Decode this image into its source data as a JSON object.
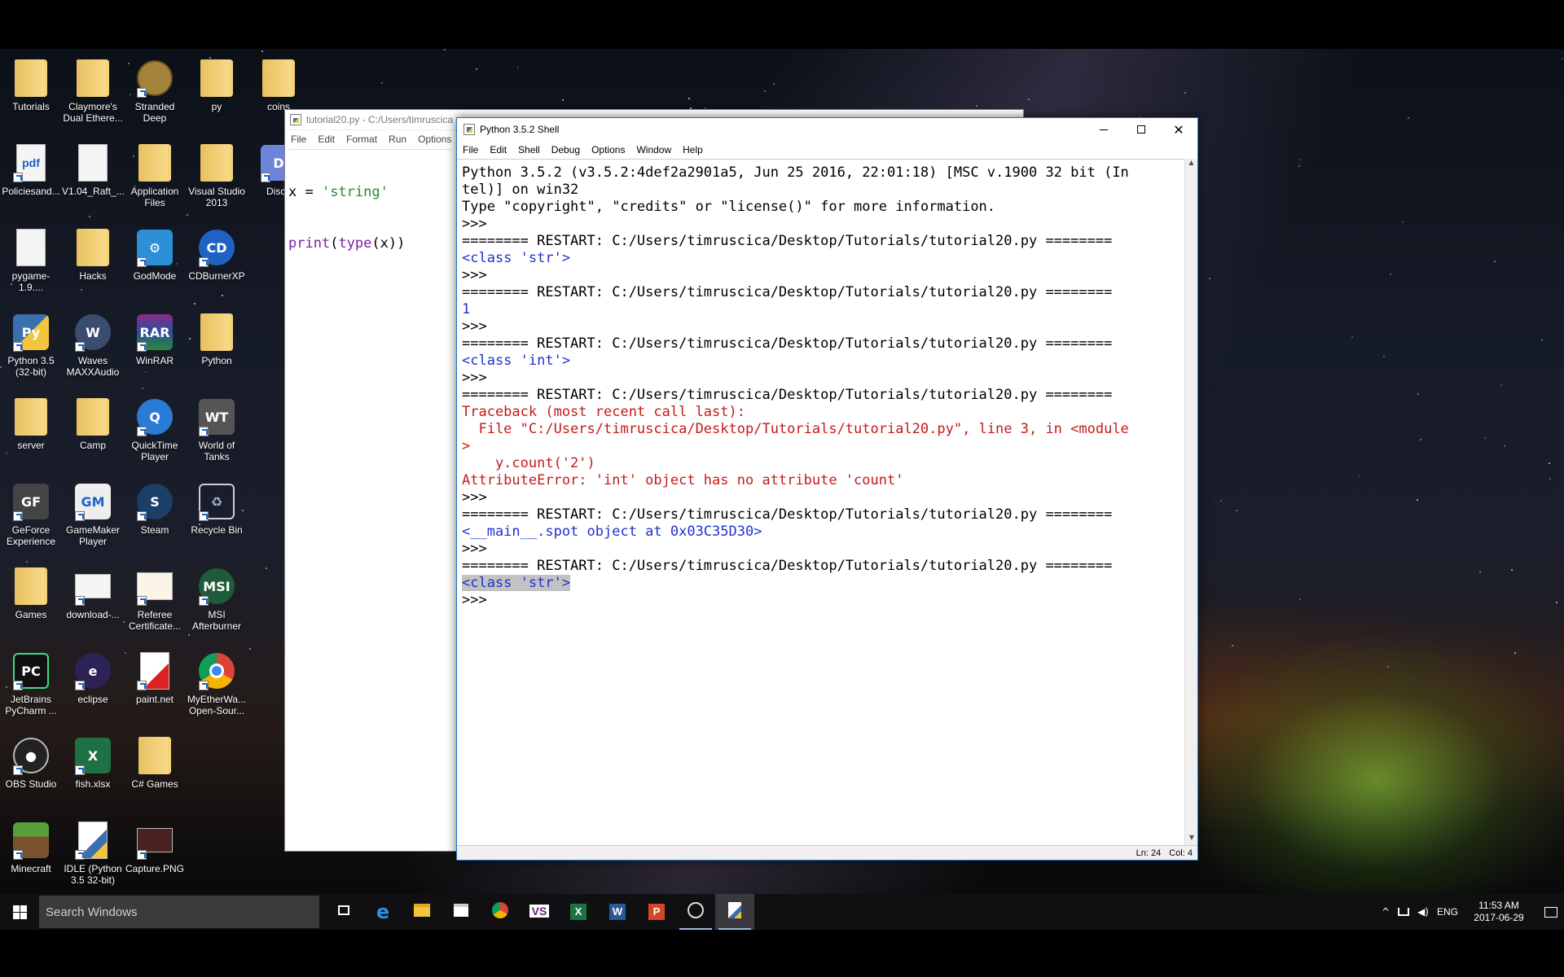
{
  "desktop_icons": [
    {
      "label": "Tutorials",
      "kind": "folder"
    },
    {
      "label": "Claymore's Dual Ethere...",
      "kind": "folder"
    },
    {
      "label": "Stranded Deep",
      "kind": "app-stranded"
    },
    {
      "label": "py",
      "kind": "folder"
    },
    {
      "label": "coins",
      "kind": "folder"
    },
    {
      "label": "Policiesand...",
      "kind": "pdf"
    },
    {
      "label": "V1.04_Raft_...",
      "kind": "doc"
    },
    {
      "label": "Application Files",
      "kind": "folder"
    },
    {
      "label": "Visual Studio 2013",
      "kind": "folder"
    },
    {
      "label": "Disco",
      "kind": "discord"
    },
    {
      "label": "pygame-1.9....",
      "kind": "doc"
    },
    {
      "label": "Hacks",
      "kind": "folder"
    },
    {
      "label": "GodMode",
      "kind": "godmode"
    },
    {
      "label": "CDBurnerXP",
      "kind": "cdburner"
    },
    {
      "label": "Python 3.5 (32-bit)",
      "kind": "python"
    },
    {
      "label": "Waves MAXXAudio",
      "kind": "waves"
    },
    {
      "label": "WinRAR",
      "kind": "winrar"
    },
    {
      "label": "Python",
      "kind": "folder"
    },
    {
      "label": "server",
      "kind": "folder"
    },
    {
      "label": "Camp",
      "kind": "folder"
    },
    {
      "label": "QuickTime Player",
      "kind": "quicktime"
    },
    {
      "label": "World of Tanks",
      "kind": "wot"
    },
    {
      "label": "GeForce Experience",
      "kind": "geforce"
    },
    {
      "label": "GameMaker Player",
      "kind": "gamemaker"
    },
    {
      "label": "Steam",
      "kind": "steam"
    },
    {
      "label": "Recycle Bin",
      "kind": "recycle"
    },
    {
      "label": "Games",
      "kind": "folder"
    },
    {
      "label": "download-...",
      "kind": "image"
    },
    {
      "label": "Referee Certificate...",
      "kind": "certificate"
    },
    {
      "label": "MSI Afterburner",
      "kind": "msi"
    },
    {
      "label": "JetBrains PyCharm ...",
      "kind": "pycharm"
    },
    {
      "label": "eclipse",
      "kind": "eclipse"
    },
    {
      "label": "paint.net",
      "kind": "paintnet"
    },
    {
      "label": "MyEtherWa... Open-Sour...",
      "kind": "chrome"
    },
    {
      "label": "OBS Studio",
      "kind": "obs"
    },
    {
      "label": "fish.xlsx",
      "kind": "excel"
    },
    {
      "label": "C# Games",
      "kind": "folder"
    },
    {
      "label": "Minecraft",
      "kind": "minecraft"
    },
    {
      "label": "IDLE (Python 3.5 32-bit)",
      "kind": "idle"
    },
    {
      "label": "Capture.PNG",
      "kind": "capture"
    }
  ],
  "editor": {
    "title": "tutorial20.py - C:/Users/timruscica",
    "menu": [
      "File",
      "Edit",
      "Format",
      "Run",
      "Options"
    ],
    "code_line1": {
      "var": "x = ",
      "str": "'string'"
    },
    "code_line2": {
      "print": "print",
      "open": "(",
      "type": "type",
      "rest": "(x))"
    }
  },
  "shell": {
    "title": "Python 3.5.2 Shell",
    "menu": [
      "File",
      "Edit",
      "Shell",
      "Debug",
      "Options",
      "Window",
      "Help"
    ],
    "lines": [
      {
        "text": "Python 3.5.2 (v3.5.2:4def2a2901a5, Jun 25 2016, 22:01:18) [MSC v.1900 32 bit (In",
        "style": ""
      },
      {
        "text": "tel)] on win32",
        "style": ""
      },
      {
        "text": "Type \"copyright\", \"credits\" or \"license()\" for more information.",
        "style": ""
      },
      {
        "text": ">>>",
        "style": ""
      },
      {
        "text": "======== RESTART: C:/Users/timruscica/Desktop/Tutorials/tutorial20.py ========",
        "style": ""
      },
      {
        "text": "<class 'str'>",
        "style": "blue"
      },
      {
        "text": ">>>",
        "style": ""
      },
      {
        "text": "======== RESTART: C:/Users/timruscica/Desktop/Tutorials/tutorial20.py ========",
        "style": ""
      },
      {
        "text": "1",
        "style": "blue"
      },
      {
        "text": ">>>",
        "style": ""
      },
      {
        "text": "======== RESTART: C:/Users/timruscica/Desktop/Tutorials/tutorial20.py ========",
        "style": ""
      },
      {
        "text": "<class 'int'>",
        "style": "blue"
      },
      {
        "text": ">>>",
        "style": ""
      },
      {
        "text": "======== RESTART: C:/Users/timruscica/Desktop/Tutorials/tutorial20.py ========",
        "style": ""
      },
      {
        "text": "Traceback (most recent call last):",
        "style": "red"
      },
      {
        "text": "  File \"C:/Users/timruscica/Desktop/Tutorials/tutorial20.py\", line 3, in <module",
        "style": "red"
      },
      {
        "text": ">",
        "style": "red"
      },
      {
        "text": "    y.count('2')",
        "style": "red"
      },
      {
        "text": "AttributeError: 'int' object has no attribute 'count'",
        "style": "red"
      },
      {
        "text": ">>>",
        "style": ""
      },
      {
        "text": "======== RESTART: C:/Users/timruscica/Desktop/Tutorials/tutorial20.py ========",
        "style": ""
      },
      {
        "text": "<__main__.spot object at 0x03C35D30>",
        "style": "blue"
      },
      {
        "text": ">>>",
        "style": ""
      },
      {
        "text": "======== RESTART: C:/Users/timruscica/Desktop/Tutorials/tutorial20.py ========",
        "style": ""
      },
      {
        "text": "<class 'str'>",
        "style": "blue sel"
      },
      {
        "text": ">>> ",
        "style": ""
      }
    ],
    "status": {
      "line": "Ln: 24",
      "col": "Col: 4"
    }
  },
  "taskbar": {
    "search_placeholder": "Search Windows",
    "apps": [
      "task-view",
      "edge",
      "file-explorer",
      "store",
      "chrome",
      "visual-studio",
      "excel",
      "word",
      "powerpoint",
      "obs",
      "python-idle"
    ],
    "tray": {
      "language": "ENG",
      "time": "11:53 AM",
      "date": "2017-06-29"
    }
  }
}
